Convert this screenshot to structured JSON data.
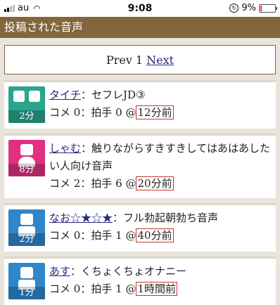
{
  "status_bar": {
    "carrier": "au",
    "time": "9:08",
    "battery_percent": "9%",
    "battery_level": 0.09
  },
  "page_title": "投稿された音声",
  "pager": {
    "prev_label": "Prev",
    "current_page": "1",
    "next_label": "Next"
  },
  "colors": {
    "title_bar": "#84653c",
    "avatar_teal": "#2aa58d",
    "avatar_pink": "#e0307f",
    "avatar_blue": "#2f86cb"
  },
  "posts": [
    {
      "author": "タイチ",
      "sep": "：",
      "title": "セフレJD③",
      "comments_label": "コメ",
      "comments": "0",
      "claps_label": "拍手",
      "claps": "0",
      "at": "@",
      "ago": "12分前",
      "duration": "2分",
      "avatar_icon": "couple-avatar-icon"
    },
    {
      "author": "しゃむ",
      "sep": "：",
      "title": "触りながらすきすきしてはあはあしたい人向け音声",
      "comments_label": "コメ",
      "comments": "2",
      "claps_label": "拍手",
      "claps": "6",
      "at": "@",
      "ago": "20分前",
      "duration": "8分",
      "avatar_icon": "female-avatar-icon"
    },
    {
      "author": "なお☆★☆★",
      "sep": "：",
      "title": "フル勃起朝勃ち音声",
      "comments_label": "コメ",
      "comments": "0",
      "claps_label": "拍手",
      "claps": "1",
      "at": "@",
      "ago": "40分前",
      "duration": "2分",
      "avatar_icon": "male-avatar-icon"
    },
    {
      "author": "あす",
      "sep": "：",
      "title": "くちょくちょオナニー",
      "comments_label": "コメ",
      "comments": "0",
      "claps_label": "拍手",
      "claps": "1",
      "at": "@",
      "ago": "1時間前",
      "duration": "1分",
      "avatar_icon": "male-avatar-icon"
    }
  ]
}
